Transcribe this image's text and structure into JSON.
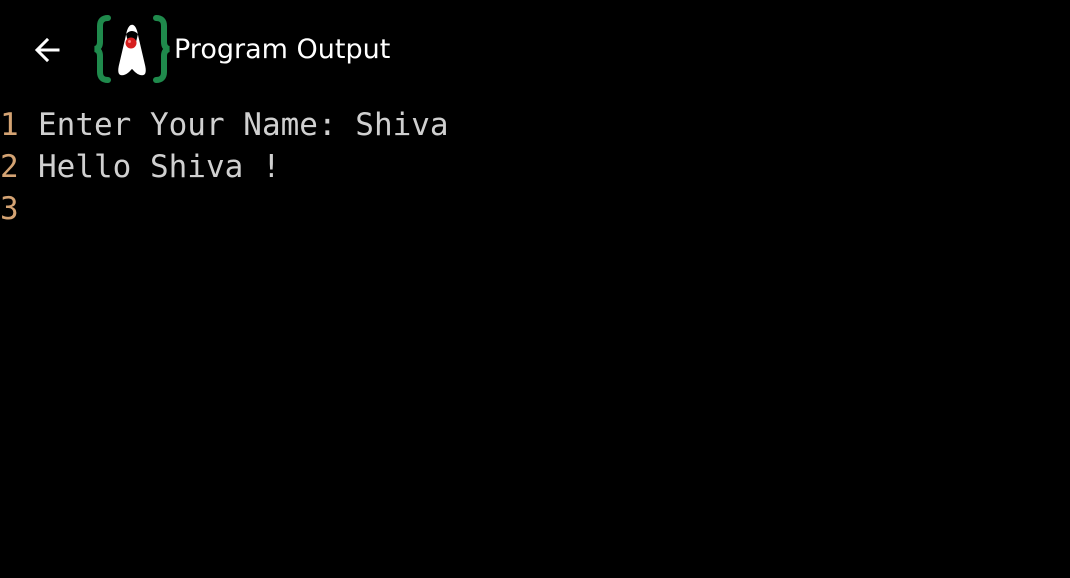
{
  "toolbar": {
    "title": "Program Output",
    "back_icon": "arrow-left-icon",
    "logo_icon": "java-duke-braces-logo"
  },
  "colors": {
    "background": "#000000",
    "title": "#ffffff",
    "line_number": "#d4a373",
    "output_text": "#d0d0d0",
    "logo_braces": "#1f8a4c",
    "logo_nose": "#d61e1e"
  },
  "output": {
    "lines": [
      {
        "number": "1",
        "text": "Enter Your Name: Shiva"
      },
      {
        "number": "2",
        "text": "Hello Shiva !"
      },
      {
        "number": "3",
        "text": ""
      }
    ]
  }
}
